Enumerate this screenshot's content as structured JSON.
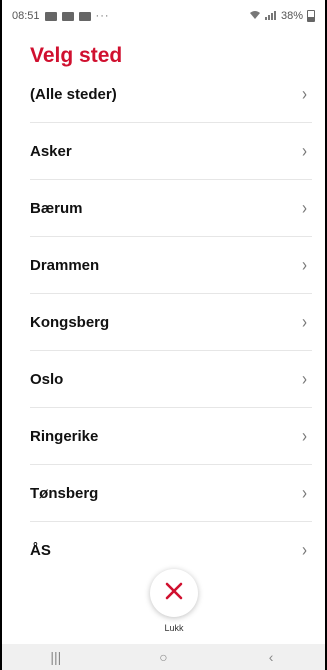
{
  "status_bar": {
    "time": "08:51",
    "icons_left": [
      "message-icon",
      "mail-icon",
      "image-icon"
    ],
    "dots": "···",
    "battery": "38%"
  },
  "title": "Velg sted",
  "items": [
    {
      "label": "(Alle steder)"
    },
    {
      "label": "Asker"
    },
    {
      "label": "Bærum"
    },
    {
      "label": "Drammen"
    },
    {
      "label": "Kongsberg"
    },
    {
      "label": "Oslo"
    },
    {
      "label": "Ringerike"
    },
    {
      "label": "Tønsberg"
    },
    {
      "label": "ÅS"
    }
  ],
  "chevron": "›",
  "close": {
    "label": "Lukk",
    "color": "#d0102f"
  },
  "nav": {
    "recent": "|||",
    "home": "○",
    "back": "‹"
  },
  "accent": "#d0102f"
}
